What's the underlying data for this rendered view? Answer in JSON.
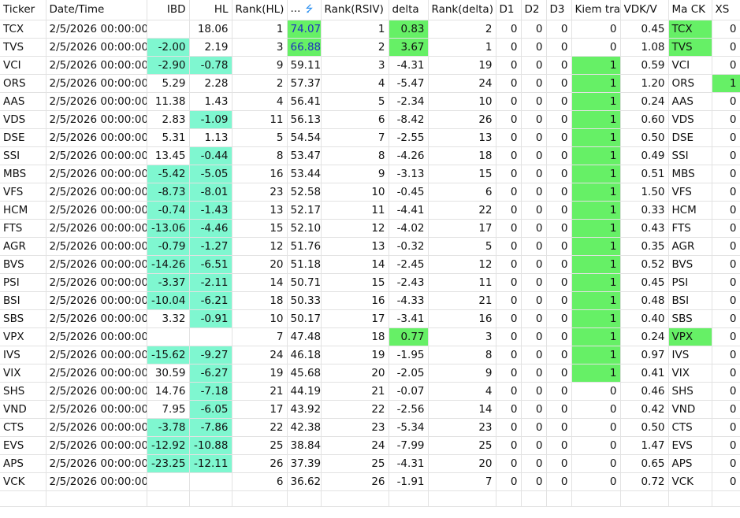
{
  "headers": [
    "Ticker",
    "Date/Time",
    "IBD",
    "HL",
    "Rank(HL)",
    "...",
    "Rank(RSIV)",
    "delta",
    "Rank(delta)",
    "D1",
    "D2",
    "D3",
    "Kiem tra",
    "VDK/V",
    "Ma CK",
    "XS"
  ],
  "sort_icon": "sort-descending-icon",
  "colors": {
    "aqua": "#7ff7d0",
    "green": "#66f066",
    "blue_text": "#1f2fbf"
  },
  "rows": [
    [
      "TCX",
      "2/5/2026 00:00:00",
      "",
      "18.06",
      "1",
      "74.07",
      "1",
      "0.83",
      "2",
      "0",
      "0",
      "0",
      "0",
      "0.45",
      "TCX",
      "0"
    ],
    [
      "TVS",
      "2/5/2026 00:00:00",
      "-2.00",
      "2.19",
      "3",
      "66.88",
      "2",
      "3.67",
      "1",
      "0",
      "0",
      "0",
      "0",
      "1.08",
      "TVS",
      "0"
    ],
    [
      "VCI",
      "2/5/2026 00:00:00",
      "-2.90",
      "-0.78",
      "9",
      "59.11",
      "3",
      "-4.31",
      "19",
      "0",
      "0",
      "0",
      "1",
      "0.59",
      "VCI",
      "0"
    ],
    [
      "ORS",
      "2/5/2026 00:00:00",
      "5.29",
      "2.28",
      "2",
      "57.37",
      "4",
      "-5.47",
      "24",
      "0",
      "0",
      "0",
      "1",
      "1.20",
      "ORS",
      "1"
    ],
    [
      "AAS",
      "2/5/2026 00:00:00",
      "11.38",
      "1.43",
      "4",
      "56.41",
      "5",
      "-2.34",
      "10",
      "0",
      "0",
      "0",
      "1",
      "0.24",
      "AAS",
      "0"
    ],
    [
      "VDS",
      "2/5/2026 00:00:00",
      "2.83",
      "-1.09",
      "11",
      "56.13",
      "6",
      "-8.42",
      "26",
      "0",
      "0",
      "0",
      "1",
      "0.60",
      "VDS",
      "0"
    ],
    [
      "DSE",
      "2/5/2026 00:00:00",
      "5.31",
      "1.13",
      "5",
      "54.54",
      "7",
      "-2.55",
      "13",
      "0",
      "0",
      "0",
      "1",
      "0.50",
      "DSE",
      "0"
    ],
    [
      "SSI",
      "2/5/2026 00:00:00",
      "13.45",
      "-0.44",
      "8",
      "53.47",
      "8",
      "-4.26",
      "18",
      "0",
      "0",
      "0",
      "1",
      "0.49",
      "SSI",
      "0"
    ],
    [
      "MBS",
      "2/5/2026 00:00:00",
      "-5.42",
      "-5.05",
      "16",
      "53.44",
      "9",
      "-3.13",
      "15",
      "0",
      "0",
      "0",
      "1",
      "0.51",
      "MBS",
      "0"
    ],
    [
      "VFS",
      "2/5/2026 00:00:00",
      "-8.73",
      "-8.01",
      "23",
      "52.58",
      "10",
      "-0.45",
      "6",
      "0",
      "0",
      "0",
      "1",
      "1.50",
      "VFS",
      "0"
    ],
    [
      "HCM",
      "2/5/2026 00:00:00",
      "-0.74",
      "-1.43",
      "13",
      "52.17",
      "11",
      "-4.41",
      "22",
      "0",
      "0",
      "0",
      "1",
      "0.33",
      "HCM",
      "0"
    ],
    [
      "FTS",
      "2/5/2026 00:00:00",
      "-13.06",
      "-4.46",
      "15",
      "52.10",
      "12",
      "-4.02",
      "17",
      "0",
      "0",
      "0",
      "1",
      "0.43",
      "FTS",
      "0"
    ],
    [
      "AGR",
      "2/5/2026 00:00:00",
      "-0.79",
      "-1.27",
      "12",
      "51.76",
      "13",
      "-0.32",
      "5",
      "0",
      "0",
      "0",
      "1",
      "0.35",
      "AGR",
      "0"
    ],
    [
      "BVS",
      "2/5/2026 00:00:00",
      "-14.26",
      "-6.51",
      "20",
      "51.18",
      "14",
      "-2.45",
      "12",
      "0",
      "0",
      "0",
      "1",
      "0.52",
      "BVS",
      "0"
    ],
    [
      "PSI",
      "2/5/2026 00:00:00",
      "-3.37",
      "-2.11",
      "14",
      "50.71",
      "15",
      "-2.43",
      "11",
      "0",
      "0",
      "0",
      "1",
      "0.45",
      "PSI",
      "0"
    ],
    [
      "BSI",
      "2/5/2026 00:00:00",
      "-10.04",
      "-6.21",
      "18",
      "50.33",
      "16",
      "-4.33",
      "21",
      "0",
      "0",
      "0",
      "1",
      "0.48",
      "BSI",
      "0"
    ],
    [
      "SBS",
      "2/5/2026 00:00:00",
      "3.32",
      "-0.91",
      "10",
      "50.17",
      "17",
      "-3.41",
      "16",
      "0",
      "0",
      "0",
      "1",
      "0.40",
      "SBS",
      "0"
    ],
    [
      "VPX",
      "2/5/2026 00:00:00",
      "",
      "",
      "7",
      "47.48",
      "18",
      "0.77",
      "3",
      "0",
      "0",
      "0",
      "1",
      "0.24",
      "VPX",
      "0"
    ],
    [
      "IVS",
      "2/5/2026 00:00:00",
      "-15.62",
      "-9.27",
      "24",
      "46.18",
      "19",
      "-1.95",
      "8",
      "0",
      "0",
      "0",
      "1",
      "0.97",
      "IVS",
      "0"
    ],
    [
      "VIX",
      "2/5/2026 00:00:00",
      "30.59",
      "-6.27",
      "19",
      "45.68",
      "20",
      "-2.05",
      "9",
      "0",
      "0",
      "0",
      "1",
      "0.41",
      "VIX",
      "0"
    ],
    [
      "SHS",
      "2/5/2026 00:00:00",
      "14.76",
      "-7.18",
      "21",
      "44.19",
      "21",
      "-0.07",
      "4",
      "0",
      "0",
      "0",
      "0",
      "0.46",
      "SHS",
      "0"
    ],
    [
      "VND",
      "2/5/2026 00:00:00",
      "7.95",
      "-6.05",
      "17",
      "43.92",
      "22",
      "-2.56",
      "14",
      "0",
      "0",
      "0",
      "0",
      "0.42",
      "VND",
      "0"
    ],
    [
      "CTS",
      "2/5/2026 00:00:00",
      "-3.78",
      "-7.86",
      "22",
      "42.38",
      "23",
      "-5.34",
      "23",
      "0",
      "0",
      "0",
      "0",
      "0.50",
      "CTS",
      "0"
    ],
    [
      "EVS",
      "2/5/2026 00:00:00",
      "-12.92",
      "-10.88",
      "25",
      "38.84",
      "24",
      "-7.99",
      "25",
      "0",
      "0",
      "0",
      "0",
      "1.47",
      "EVS",
      "0"
    ],
    [
      "APS",
      "2/5/2026 00:00:00",
      "-23.25",
      "-12.11",
      "26",
      "37.39",
      "25",
      "-4.31",
      "20",
      "0",
      "0",
      "0",
      "0",
      "0.65",
      "APS",
      "0"
    ],
    [
      "VCK",
      "2/5/2026 00:00:00",
      "",
      "",
      "6",
      "36.62",
      "26",
      "-1.91",
      "7",
      "0",
      "0",
      "0",
      "0",
      "0.72",
      "VCK",
      "0"
    ]
  ]
}
